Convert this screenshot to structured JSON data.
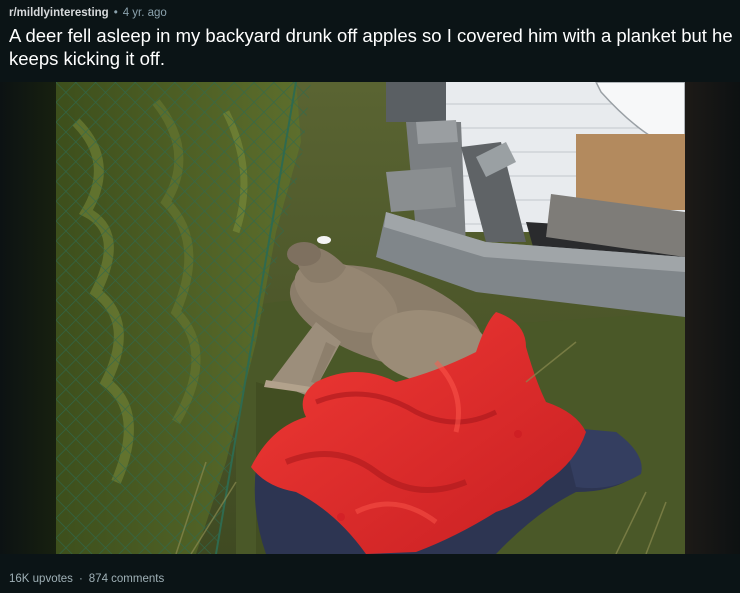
{
  "post": {
    "subreddit": "r/mildlyinteresting",
    "separator": "•",
    "age": "4 yr. ago",
    "title": "A deer fell asleep in my backyard drunk off apples so I covered him with a planket but he keeps kicking it off.",
    "image_icon": "photo-image",
    "upvotes": "16K upvotes",
    "footer_separator": "·",
    "comments": "874 comments"
  },
  "colors": {
    "background": "#0b1416",
    "blanket_red": "#e02a2a",
    "blanket_navy": "#2c3550",
    "grass": "#4d5a2a",
    "deer": "#8a7c69"
  }
}
